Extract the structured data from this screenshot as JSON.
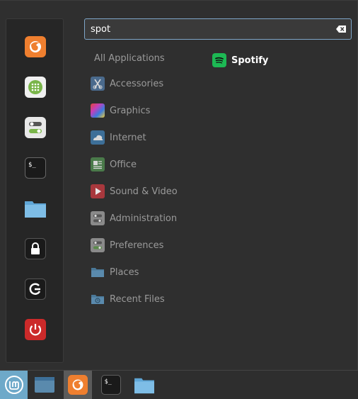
{
  "search": {
    "value": "spot"
  },
  "categories": {
    "all": "All Applications",
    "items": [
      {
        "label": "Accessories"
      },
      {
        "label": "Graphics"
      },
      {
        "label": "Internet"
      },
      {
        "label": "Office"
      },
      {
        "label": "Sound & Video"
      },
      {
        "label": "Administration"
      },
      {
        "label": "Preferences"
      },
      {
        "label": "Places"
      },
      {
        "label": "Recent Files"
      }
    ]
  },
  "results": [
    {
      "label": "Spotify",
      "icon": "spotify-icon"
    }
  ],
  "favorites": [
    {
      "icon": "firefox-icon"
    },
    {
      "icon": "software-manager-icon"
    },
    {
      "icon": "system-settings-icon"
    },
    {
      "icon": "terminal-icon"
    },
    {
      "icon": "files-icon"
    },
    {
      "icon": "lock-screen-icon"
    },
    {
      "icon": "logout-icon"
    },
    {
      "icon": "power-icon"
    }
  ],
  "taskbar": [
    {
      "icon": "mint-menu-icon"
    },
    {
      "icon": "show-desktop-icon"
    },
    {
      "icon": "firefox-icon"
    },
    {
      "icon": "terminal-icon"
    },
    {
      "icon": "files-icon"
    }
  ],
  "colors": {
    "accent": "#7ea6c8",
    "spotify": "#1db954",
    "firefox": "#ef7f2f",
    "power": "#cc2a2a",
    "mint_menu_bg": "#6ea9c9"
  }
}
